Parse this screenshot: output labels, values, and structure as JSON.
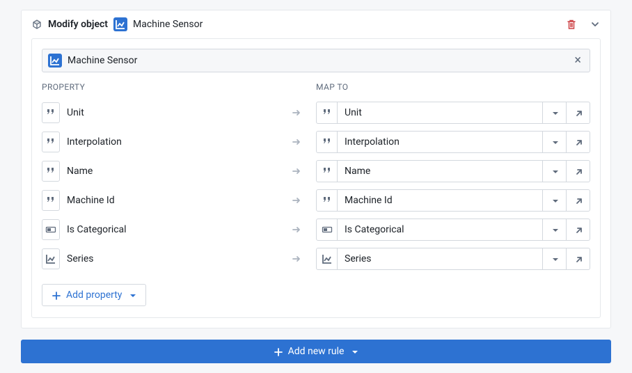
{
  "header": {
    "action_label": "Modify object",
    "object_name": "Machine Sensor",
    "object_icon": "chart-icon"
  },
  "object_bar": {
    "label": "Machine Sensor"
  },
  "columns": {
    "property_header": "PROPERTY",
    "map_to_header": "MAP TO"
  },
  "rows": [
    {
      "prop_type": "string",
      "prop_label": "Unit",
      "map_type": "string",
      "map_label": "Unit"
    },
    {
      "prop_type": "string",
      "prop_label": "Interpolation",
      "map_type": "string",
      "map_label": "Interpolation"
    },
    {
      "prop_type": "string",
      "prop_label": "Name",
      "map_type": "string",
      "map_label": "Name"
    },
    {
      "prop_type": "string",
      "prop_label": "Machine Id",
      "map_type": "string",
      "map_label": "Machine Id"
    },
    {
      "prop_type": "boolean",
      "prop_label": "Is Categorical",
      "map_type": "boolean",
      "map_label": "Is Categorical"
    },
    {
      "prop_type": "chart",
      "prop_label": "Series",
      "map_type": "chart",
      "map_label": "Series"
    }
  ],
  "add_property_label": "Add property",
  "add_rule_label": "Add new rule"
}
